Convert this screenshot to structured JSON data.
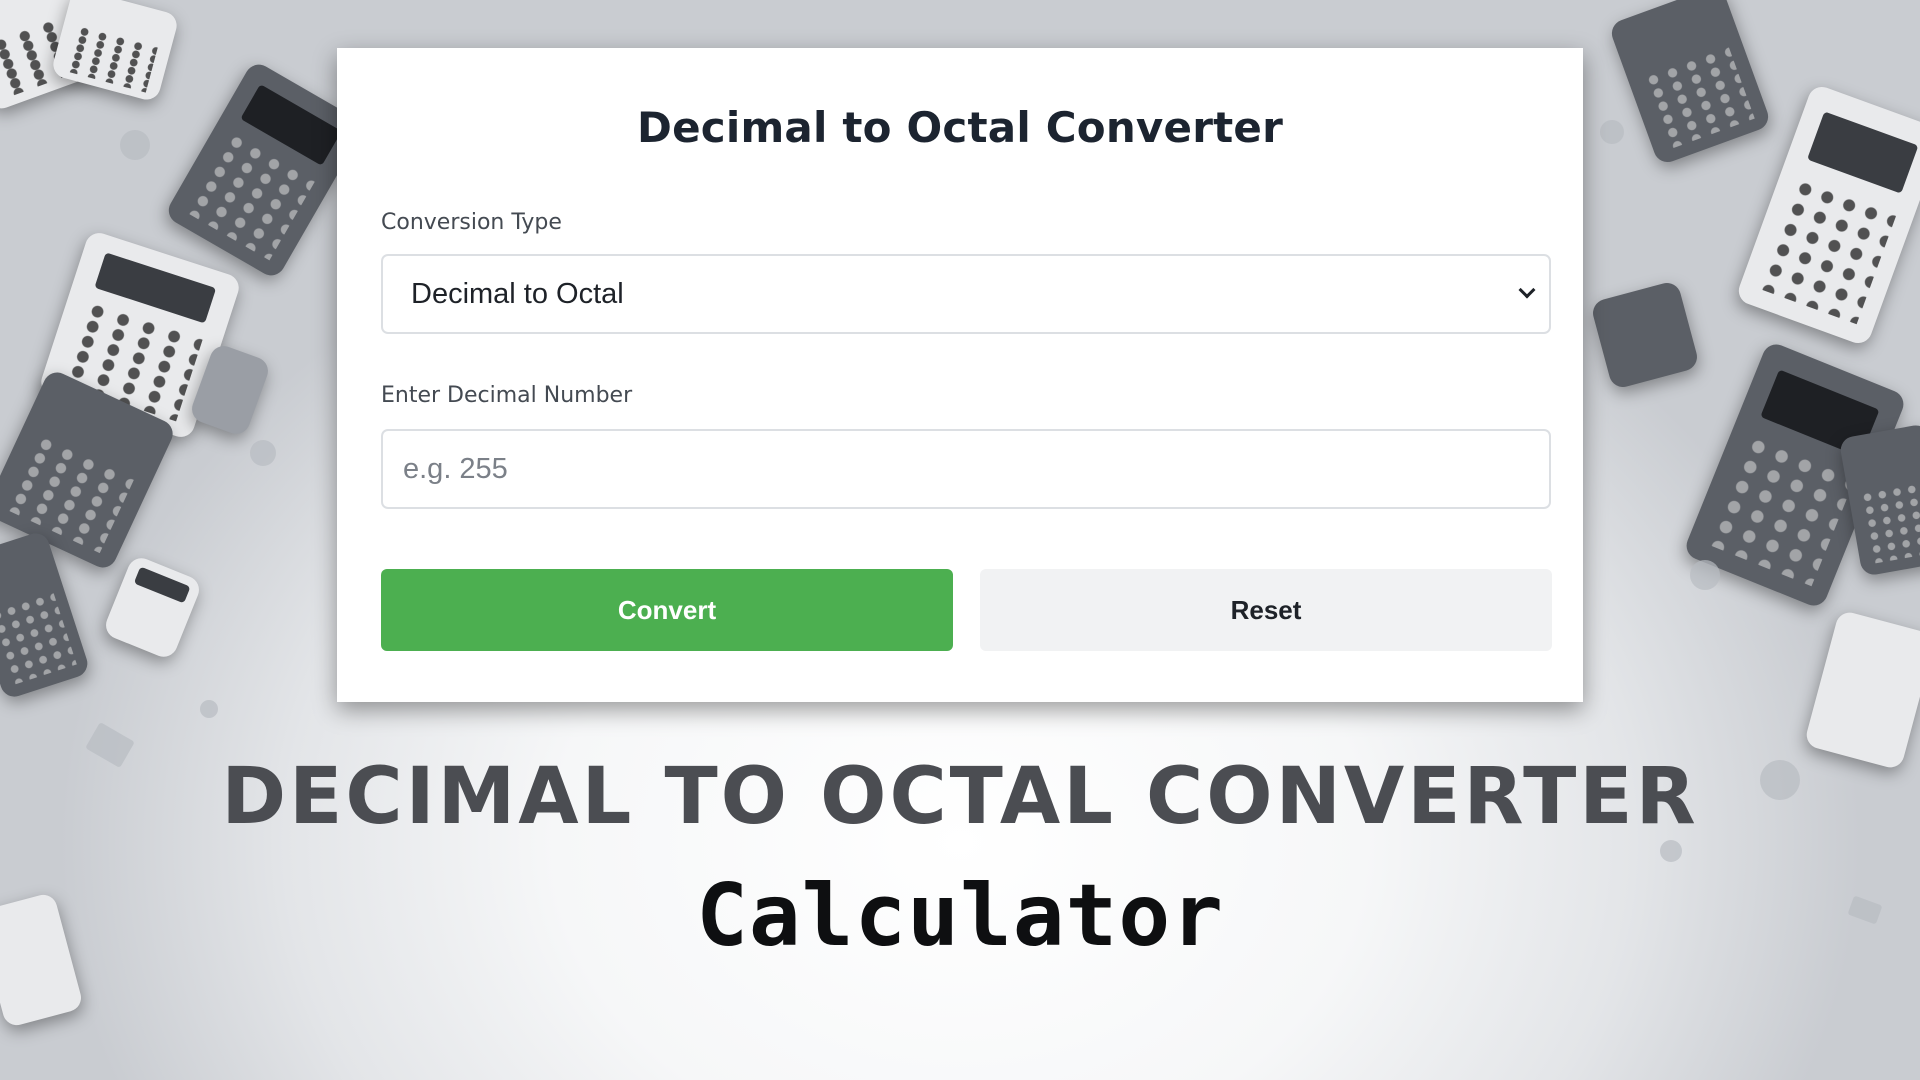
{
  "card": {
    "title": "Decimal to Octal Converter",
    "conversion_type": {
      "label": "Conversion Type",
      "selected": "Decimal to Octal"
    },
    "number_input": {
      "label": "Enter Decimal Number",
      "placeholder": "e.g. 255",
      "value": ""
    },
    "buttons": {
      "convert": "Convert",
      "reset": "Reset"
    }
  },
  "banner": {
    "headline": "DECIMAL TO OCTAL CONVERTER",
    "subline": "Calculator"
  },
  "colors": {
    "convert_button": "#4caf50",
    "reset_button": "#f1f2f3",
    "headline": "#4b4d52"
  },
  "icons": {
    "select_arrow": "chevron-down-icon"
  }
}
